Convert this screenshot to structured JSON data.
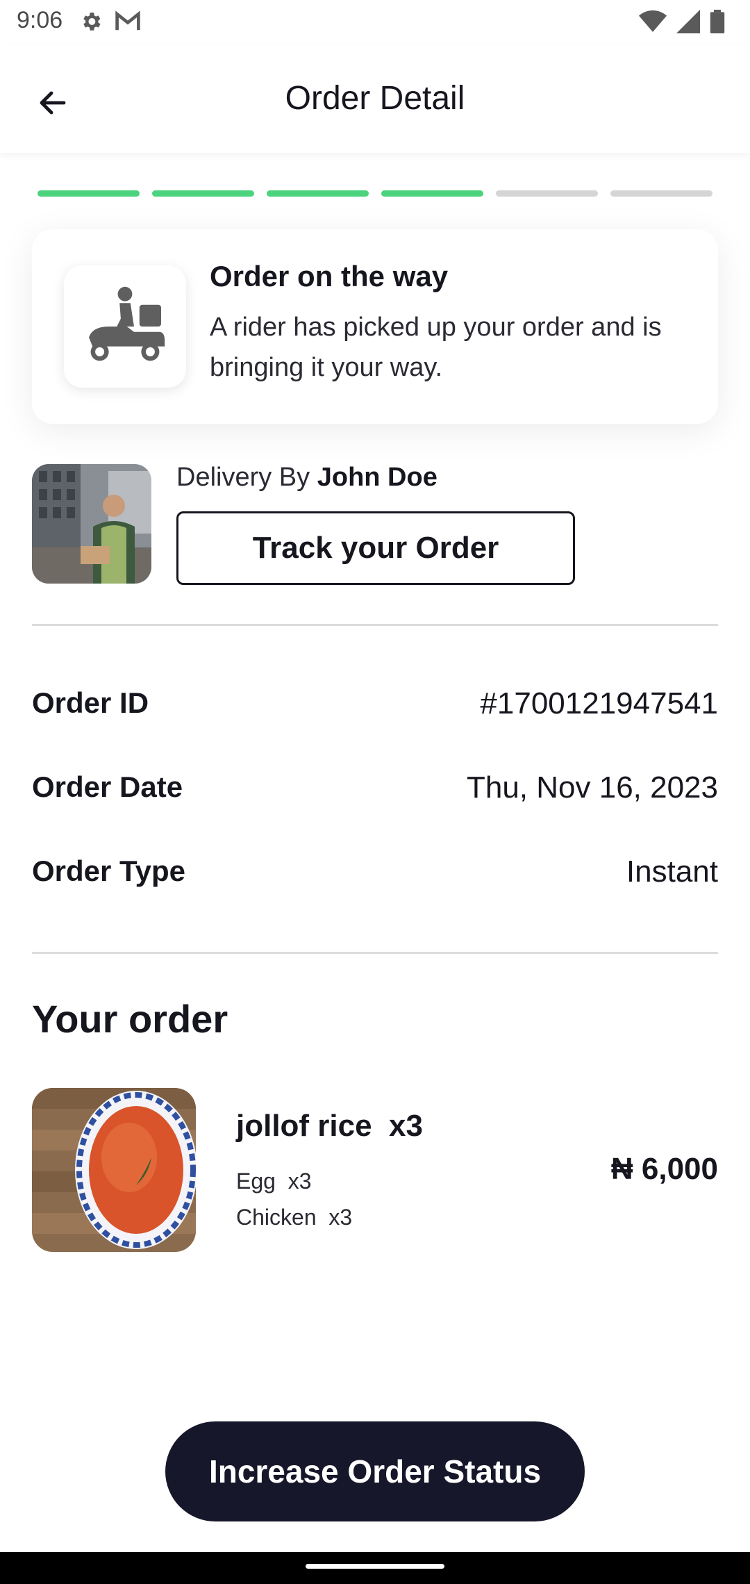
{
  "status_bar": {
    "time": "9:06",
    "left_icons": [
      "gear-icon",
      "gmail-icon"
    ],
    "right_icons": [
      "wifi-icon",
      "signal-icon",
      "battery-icon"
    ]
  },
  "header": {
    "title": "Order Detail",
    "back_icon": "arrow-left-icon"
  },
  "progress": {
    "total_steps": 6,
    "completed_steps": 4,
    "active_color": "#4cd37e",
    "inactive_color": "#d5d5d5"
  },
  "status_card": {
    "icon": "scooter-rider-icon",
    "title": "Order on the way",
    "description": "A rider has picked up your order and is bringing it your way."
  },
  "delivery": {
    "prefix": "Delivery By",
    "rider_name": "John Doe",
    "track_label": "Track your Order"
  },
  "order_info": [
    {
      "label": "Order ID",
      "value": "#1700121947541"
    },
    {
      "label": "Order Date",
      "value": "Thu, Nov 16, 2023"
    },
    {
      "label": "Order Type",
      "value": "Instant"
    }
  ],
  "your_order": {
    "title": "Your order",
    "items": [
      {
        "name": "jollof rice",
        "qty": "x3",
        "extras": [
          {
            "name": "Egg",
            "qty": "x3"
          },
          {
            "name": "Chicken",
            "qty": "x3"
          }
        ],
        "price": "₦ 6,000"
      }
    ]
  },
  "cta": {
    "label": "Increase Order Status",
    "color": "#17172b"
  }
}
